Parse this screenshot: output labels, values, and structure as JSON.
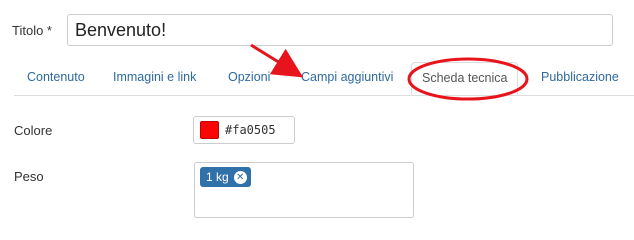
{
  "title_field": {
    "label": "Titolo *",
    "value": "Benvenuto!"
  },
  "tabs": [
    {
      "label": "Contenuto"
    },
    {
      "label": "Immagini e link"
    },
    {
      "label": "Opzioni"
    },
    {
      "label": "Campi aggiuntivi"
    },
    {
      "label": "Scheda tecnica",
      "active": true
    },
    {
      "label": "Pubblicazione"
    }
  ],
  "color_field": {
    "label": "Colore",
    "value": "#fa0505",
    "swatch_color": "#fa0505"
  },
  "weight_field": {
    "label": "Peso",
    "tags": [
      {
        "label": "1 kg",
        "remove_icon": "close-circle-icon"
      }
    ]
  },
  "annotations": {
    "arrow_color": "#e8141b",
    "circle_color": "#e8141b"
  }
}
